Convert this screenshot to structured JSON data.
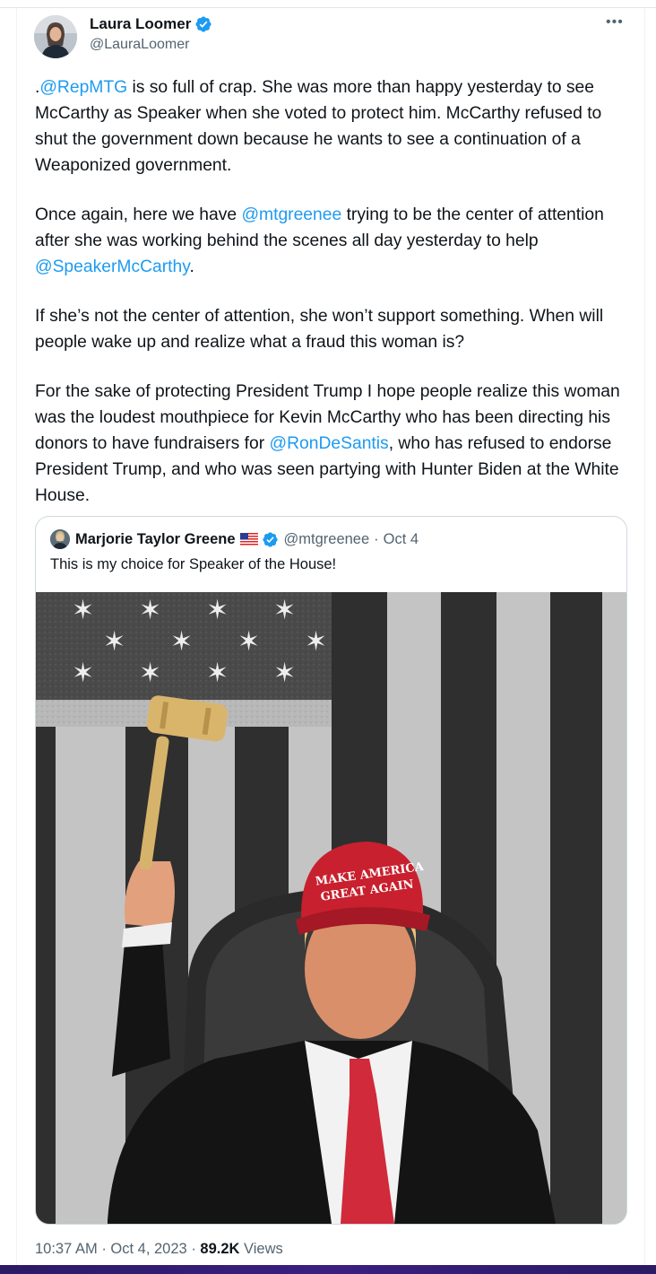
{
  "author": {
    "name": "Laura Loomer",
    "handle": "@LauraLoomer"
  },
  "tweet": {
    "paragraphs": [
      [
        {
          "t": ".",
          "m": false
        },
        {
          "t": "@RepMTG",
          "m": true
        },
        {
          "t": " is so full of crap. She was more than happy yesterday to see McCarthy as Speaker when she voted to protect him. McCarthy refused to shut the government down because he wants to see a continuation of a Weaponized government.",
          "m": false
        }
      ],
      [
        {
          "t": "Once again, here we have ",
          "m": false
        },
        {
          "t": "@mtgreenee",
          "m": true
        },
        {
          "t": " trying to be the center of attention after she was working behind the scenes all day yesterday to help ",
          "m": false
        },
        {
          "t": "@SpeakerMcCarthy",
          "m": true
        },
        {
          "t": ".",
          "m": false
        }
      ],
      [
        {
          "t": "If she’s not the center of attention, she won’t support something. When will people wake up and realize what a fraud this woman is?",
          "m": false
        }
      ],
      [
        {
          "t": "For the sake of protecting President Trump I hope people realize this woman was the loudest mouthpiece for Kevin McCarthy who has been directing his donors to have fundraisers for ",
          "m": false
        },
        {
          "t": "@RonDeSantis",
          "m": true
        },
        {
          "t": ", who has refused to endorse President Trump, and who was seen partying with Hunter Biden at the White House.",
          "m": false
        }
      ]
    ]
  },
  "quote": {
    "name": "Marjorie Taylor Greene",
    "handle": "@mtgreenee",
    "separator": "·",
    "date": "Oct 4",
    "text": "This is my choice for Speaker of the House!",
    "image": {
      "cap_text_line1": "MAKE AMERICA",
      "cap_text_line2": "GREAT AGAIN"
    }
  },
  "meta": {
    "time": "10:37 AM",
    "sep1": "·",
    "date": "Oct 4, 2023",
    "sep2": "·",
    "views_count": "89.2K",
    "views_label": "Views"
  },
  "colors": {
    "mention": "#1d9bf0",
    "verified": "#1d9bf0",
    "muted": "#536471"
  },
  "icons": [
    "verified-badge-icon",
    "more-options-icon",
    "us-flag-icon"
  ]
}
